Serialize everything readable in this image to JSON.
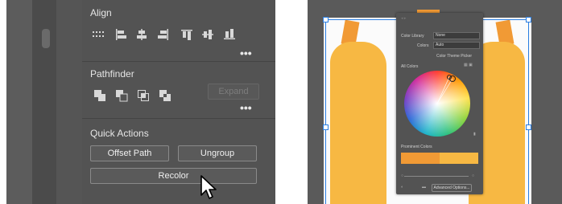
{
  "properties_panel": {
    "align": {
      "title": "Align",
      "more": "•••"
    },
    "pathfinder": {
      "title": "Pathfinder",
      "expand_label": "Expand",
      "more": "•••"
    },
    "quick_actions": {
      "title": "Quick Actions",
      "offset_path_label": "Offset Path",
      "ungroup_label": "Ungroup",
      "recolor_label": "Recolor"
    }
  },
  "recolor_dialog": {
    "color_library_label": "Color Library",
    "color_library_value": "None",
    "colors_label": "Colors",
    "colors_value": "Auto",
    "color_theme_picker_label": "Color Theme Picker",
    "all_colors_label": "All Colors",
    "prominent_colors_label": "Prominent Colors",
    "advanced_options_label": "Advanced Options..."
  },
  "colors": {
    "panel_bg": "#535353",
    "orange_cap": "#f19a35",
    "orange_body": "#f7b843",
    "selection_blue": "#2a7de1"
  }
}
